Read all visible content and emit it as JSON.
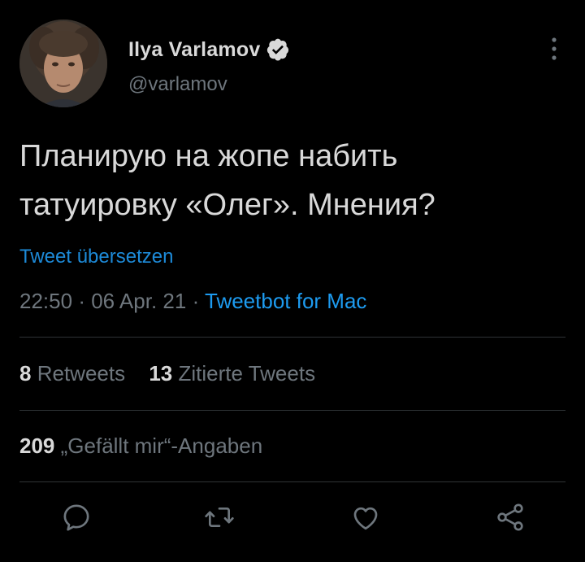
{
  "author": {
    "display_name": "Ilya Varlamov",
    "handle": "@varlamov",
    "avatar_icon": "avatar-portrait",
    "verified_icon": "verified-badge-icon"
  },
  "tweet": {
    "text_line1": "Планирую на жопе набить",
    "text_line2": "татуировку «Олег». Мнения?",
    "translate_label": "Tweet übersetzen",
    "time": "22:50",
    "separator": "·",
    "date": "06 Apr. 21",
    "source": "Tweetbot for Mac"
  },
  "stats": {
    "retweets_count": "8",
    "retweets_label": "Retweets",
    "quotes_count": "13",
    "quotes_label": "Zitierte Tweets",
    "likes_count": "209",
    "likes_label": "„Gefällt mir“-Angaben"
  },
  "actions": {
    "reply_icon": "reply-icon",
    "retweet_icon": "retweet-icon",
    "like_icon": "like-icon",
    "share_icon": "share-icon"
  },
  "colors": {
    "background": "#000000",
    "text": "#d9d9d9",
    "muted": "#6e767d",
    "link": "#1d9bf0",
    "divider": "#2f3336"
  }
}
